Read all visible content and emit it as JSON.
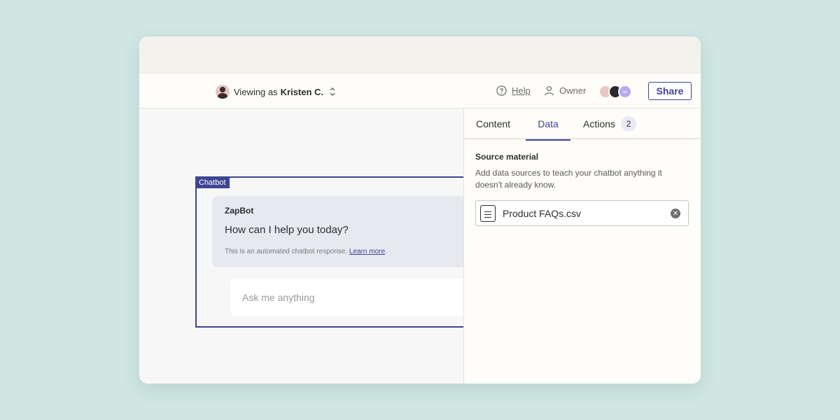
{
  "header": {
    "viewing_label": "Viewing as",
    "viewing_name": "Kristen C.",
    "help_label": "Help",
    "owner_label": "Owner",
    "share_label": "Share"
  },
  "canvas": {
    "chatbot_tag": "Chatbot",
    "bot_name": "ZapBot",
    "bot_message": "How can I help you today?",
    "disclaimer": "This is an automated chatbot response.",
    "learn_more": "Learn more",
    "input_placeholder": "Ask me anything"
  },
  "panel": {
    "tabs": [
      {
        "label": "Content"
      },
      {
        "label": "Data",
        "active": true
      },
      {
        "label": "Actions",
        "badge": "2"
      }
    ],
    "section_title": "Source material",
    "section_description": "Add data sources to teach your chatbot anything it doesn't already know.",
    "file_name": "Product FAQs.csv"
  },
  "colors": {
    "accent": "#3d4592",
    "background": "#cfe6e3"
  }
}
